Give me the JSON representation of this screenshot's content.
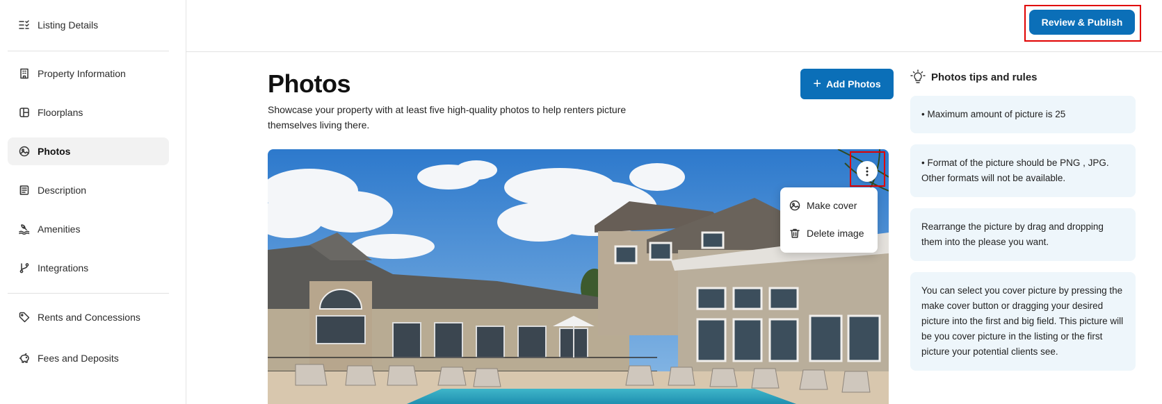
{
  "sidebar": {
    "header": {
      "label": "Listing Details",
      "icon": "checklist-icon"
    },
    "items": [
      {
        "label": "Property Information",
        "icon": "building-icon",
        "active": false
      },
      {
        "label": "Floorplans",
        "icon": "floorplan-icon",
        "active": false
      },
      {
        "label": "Photos",
        "icon": "photo-icon",
        "active": true
      },
      {
        "label": "Description",
        "icon": "document-icon",
        "active": false
      },
      {
        "label": "Amenities",
        "icon": "pool-icon",
        "active": false
      },
      {
        "label": "Integrations",
        "icon": "branch-icon",
        "active": false
      },
      {
        "label": "Rents and Concessions",
        "icon": "tag-icon",
        "active": false
      },
      {
        "label": "Fees and Deposits",
        "icon": "piggy-bank-icon",
        "active": false
      }
    ]
  },
  "topbar": {
    "review_label": "Review & Publish"
  },
  "main": {
    "title": "Photos",
    "subtitle": "Showcase your property with at least five high-quality photos to help renters picture themselves living there.",
    "add_label": "Add Photos",
    "photo_menu": {
      "make_cover": "Make cover",
      "delete_image": "Delete image"
    }
  },
  "tips": {
    "heading": "Photos tips and rules",
    "items": [
      "• Maximum amount of picture is 25",
      "• Format of the picture should be PNG , JPG. Other formats will not be available.",
      "Rearrange the picture by drag and dropping them into the please you want.",
      "You can select you cover picture by pressing the make cover button or dragging your desired picture into the first and big field. This picture will be you cover picture in the listing or the first picture your potential clients see."
    ]
  },
  "colors": {
    "accent": "#0b6fb8",
    "highlight": "#e00000",
    "tip_bg": "#eef6fb",
    "active_bg": "#f2f2f2"
  }
}
